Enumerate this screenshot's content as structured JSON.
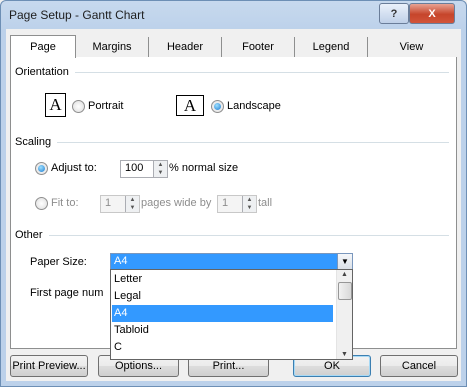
{
  "window": {
    "title": "Page Setup - Gantt Chart",
    "help_label": "?",
    "close_label": "X"
  },
  "tabs": [
    "Page",
    "Margins",
    "Header",
    "Footer",
    "Legend",
    "View"
  ],
  "orientation": {
    "section_label": "Orientation",
    "portrait_glyph": "A",
    "portrait_label": "Portrait",
    "landscape_glyph": "A",
    "landscape_label": "Landscape",
    "selected": "landscape"
  },
  "scaling": {
    "section_label": "Scaling",
    "adjust_label": "Adjust to:",
    "adjust_value": "100",
    "adjust_suffix": "% normal size",
    "fit_label": "Fit to:",
    "fit_wide_value": "1",
    "fit_wide_suffix": "pages wide by",
    "fit_tall_value": "1",
    "fit_tall_suffix": "tall",
    "selected": "adjust"
  },
  "other": {
    "section_label": "Other",
    "paper_size_label": "Paper Size:",
    "paper_size_value": "A4",
    "paper_options": [
      "Letter",
      "Legal",
      "A4",
      "Tabloid",
      "C"
    ],
    "first_page_label": "First page num"
  },
  "buttons": {
    "print_preview": "Print Preview...",
    "options": "Options...",
    "print": "Print...",
    "ok": "OK",
    "cancel": "Cancel"
  }
}
